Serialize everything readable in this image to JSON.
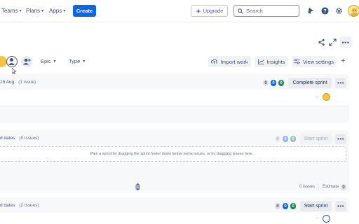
{
  "nav": {
    "teams": "Teams",
    "plans": "Plans",
    "apps": "Apps",
    "create": "Create",
    "upgrade": "Upgrade",
    "search_placeholder": "Search"
  },
  "toolbar": {
    "epic": "Epic",
    "type": "Type",
    "import_work": "Import work",
    "insights": "Insights",
    "view_settings": "View settings"
  },
  "sprints": [
    {
      "date_text": "15 Aug",
      "issues": "(1 issue)",
      "counts": [
        "0",
        "0",
        "0"
      ],
      "action": "Complete sprint"
    },
    {
      "date_text": "d dates",
      "issues": "(0 issues)",
      "counts": [
        "0",
        "0",
        "0"
      ],
      "action": "Start sprint",
      "dropzone": "Plan a sprint by dragging the sprint footer down below some issues, or by dragging issues here.",
      "footer_issues": "0 issues",
      "footer_estimate": "Estimate",
      "footer_estimate_value": "0"
    },
    {
      "date_text": "d dates",
      "issues": "(2 issues)",
      "counts": [
        "0",
        "0",
        "0"
      ],
      "action": "Start sprint"
    }
  ],
  "colors": {
    "brand": "#0c66e4",
    "done": "#1f845a",
    "upgrade": "#5e4db2"
  }
}
